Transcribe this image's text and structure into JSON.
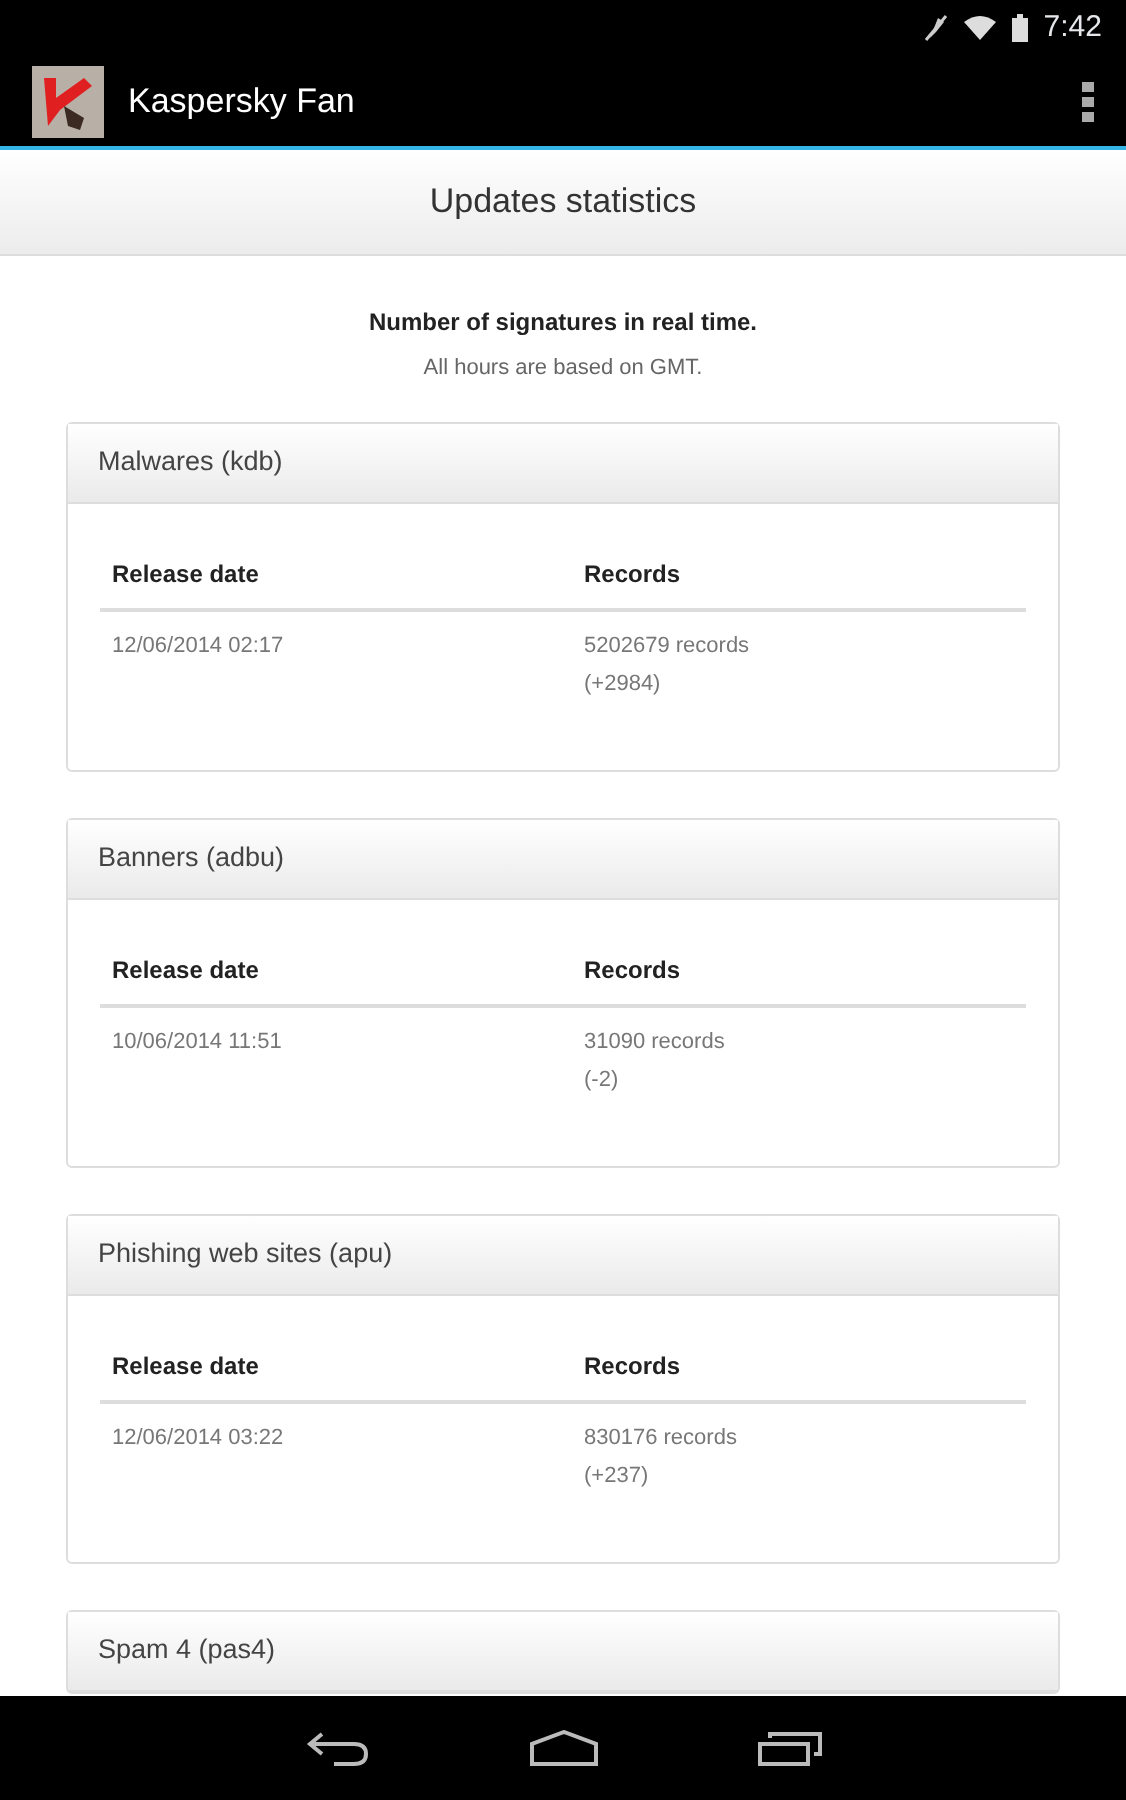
{
  "status_bar": {
    "time": "7:42"
  },
  "app_bar": {
    "title": "Kaspersky Fan"
  },
  "page_title": "Updates statistics",
  "intro": {
    "heading": "Number of signatures in real time.",
    "note": "All hours are based on GMT."
  },
  "cards": [
    {
      "title": "Malwares (kdb)",
      "columns": [
        "Release date",
        "Records"
      ],
      "rows": [
        {
          "date": "12/06/2014 02:17",
          "records": "5202679 records",
          "delta": "(+2984)"
        }
      ]
    },
    {
      "title": "Banners (adbu)",
      "columns": [
        "Release date",
        "Records"
      ],
      "rows": [
        {
          "date": "10/06/2014 11:51",
          "records": "31090 records",
          "delta": "(-2)"
        }
      ]
    },
    {
      "title": "Phishing web sites (apu)",
      "columns": [
        "Release date",
        "Records"
      ],
      "rows": [
        {
          "date": "12/06/2014 03:22",
          "records": "830176 records",
          "delta": "(+237)"
        }
      ]
    },
    {
      "title": "Spam 4 (pas4)"
    }
  ]
}
